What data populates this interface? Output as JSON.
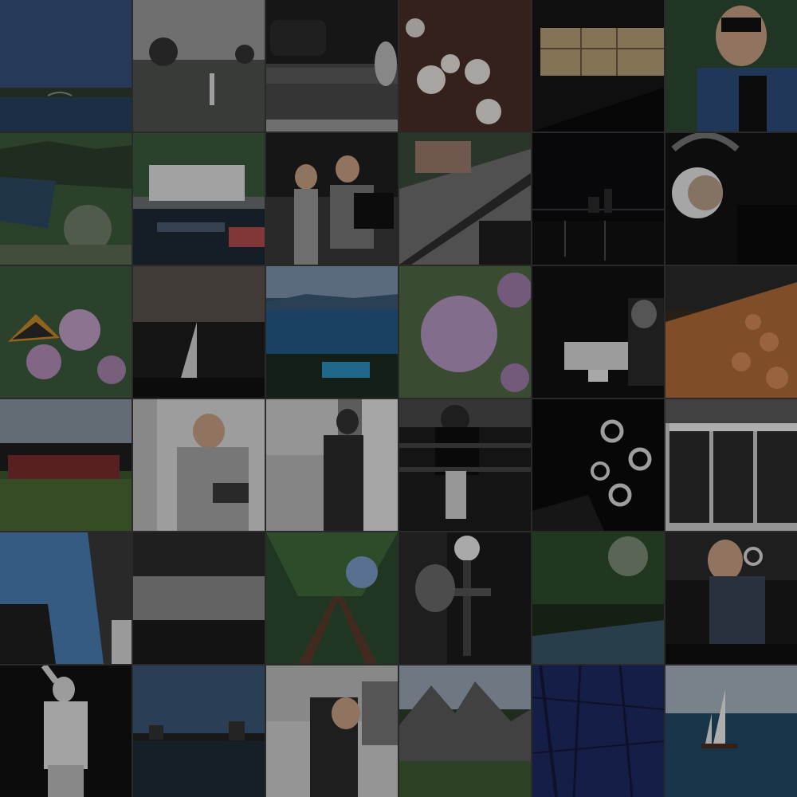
{
  "grid": {
    "columns": 6,
    "rows": 6
  },
  "photos": [
    {
      "subject": "lake-with-bridge-at-dusk"
    },
    {
      "subject": "person-in-grassy-field"
    },
    {
      "subject": "woman-beside-car-and-railing"
    },
    {
      "subject": "chocolate-dessert-with-marshmallows"
    },
    {
      "subject": "dim-interior-with-window"
    },
    {
      "subject": "man-with-glasses-portrait"
    },
    {
      "subject": "coastal-town-aerial-view"
    },
    {
      "subject": "outdoor-cafe-tables"
    },
    {
      "subject": "two-men-outdoors"
    },
    {
      "subject": "street-with-cars-from-above"
    },
    {
      "subject": "city-skyline-at-night"
    },
    {
      "subject": "headphones-closeup"
    },
    {
      "subject": "butterfly-on-purple-flowers"
    },
    {
      "subject": "dark-interior-silhouette"
    },
    {
      "subject": "harbor-with-palms-and-pool"
    },
    {
      "subject": "purple-flower-closeup"
    },
    {
      "subject": "person-with-board-game"
    },
    {
      "subject": "fruit-stand"
    },
    {
      "subject": "crowd-on-sports-field"
    },
    {
      "subject": "man-pouring-drink"
    },
    {
      "subject": "man-in-coat-by-house"
    },
    {
      "subject": "person-at-fence"
    },
    {
      "subject": "smoke-rings"
    },
    {
      "subject": "snowy-recycling-bins"
    },
    {
      "subject": "buildings-against-sky"
    },
    {
      "subject": "calm-water-shore"
    },
    {
      "subject": "tall-trees-from-below"
    },
    {
      "subject": "hookah-smoke"
    },
    {
      "subject": "forest-river"
    },
    {
      "subject": "person-exhaling-smoke"
    },
    {
      "subject": "dancer-black-and-white"
    },
    {
      "subject": "city-waterfront-at-dusk"
    },
    {
      "subject": "smiling-woman-outdoors"
    },
    {
      "subject": "mountain-cliffs-valley"
    },
    {
      "subject": "blue-textured-wall"
    },
    {
      "subject": "sailboat-on-sea"
    }
  ]
}
